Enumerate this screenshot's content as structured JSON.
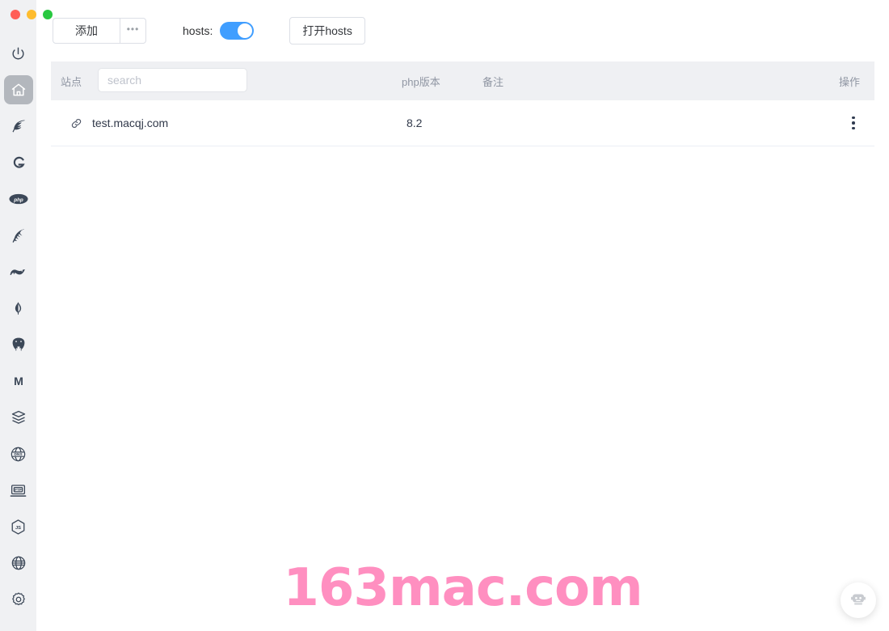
{
  "window": {
    "traffic_lights": [
      {
        "name": "close",
        "color": "#FF5F57"
      },
      {
        "name": "minimize",
        "color": "#FEBC2E"
      },
      {
        "name": "zoom",
        "color": "#28C840"
      }
    ]
  },
  "sidebar": {
    "items": [
      {
        "icon": "power-icon",
        "label": "",
        "active": false
      },
      {
        "icon": "home-icon",
        "label": "",
        "active": true
      },
      {
        "icon": "nginx-icon",
        "label": "",
        "active": false
      },
      {
        "icon": "g-letter-icon",
        "label": "",
        "active": false
      },
      {
        "icon": "php-icon",
        "label": "",
        "active": false
      },
      {
        "icon": "apache-feather-icon",
        "label": "",
        "active": false
      },
      {
        "icon": "mariadb-sealion-icon",
        "label": "",
        "active": false
      },
      {
        "icon": "mongodb-leaf-icon",
        "label": "",
        "active": false
      },
      {
        "icon": "postgresql-elephant-icon",
        "label": "",
        "active": false
      },
      {
        "icon": "m-letter-icon",
        "label": "",
        "active": false
      },
      {
        "icon": "database-stack-icon",
        "label": "",
        "active": false
      },
      {
        "icon": "dns-icon",
        "label": "",
        "active": false
      },
      {
        "icon": "ftp-icon",
        "label": "",
        "active": false
      },
      {
        "icon": "nodejs-hexagon-icon",
        "label": "",
        "active": false
      },
      {
        "icon": "globe-icon",
        "label": "",
        "active": false
      },
      {
        "icon": "settings-gear-icon",
        "label": "",
        "active": false
      }
    ]
  },
  "toolbar": {
    "add_label": "添加",
    "more_label": "•••",
    "hosts_label": "hosts:",
    "hosts_toggle_on": true,
    "hosts_toggle_color": "#409EFF",
    "open_hosts_label": "打开hosts"
  },
  "table": {
    "headers": {
      "site": "站点",
      "php_version": "php版本",
      "note": "备注",
      "action": "操作"
    },
    "search": {
      "placeholder": "search",
      "value": ""
    },
    "rows": [
      {
        "site": "test.macqj.com",
        "php_version": "8.2",
        "note": "",
        "action_icon": "more-vertical-icon"
      }
    ]
  },
  "watermark": {
    "text": "163mac.com",
    "color": "#FF8FC0"
  },
  "chat_fab": {
    "icon": "robot-assistant-icon"
  }
}
